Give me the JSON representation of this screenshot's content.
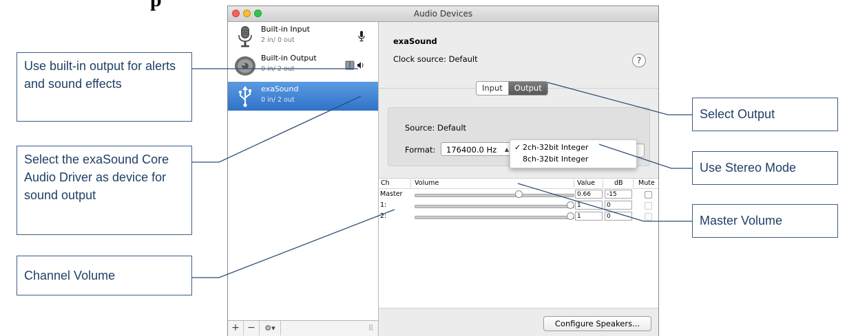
{
  "page": {
    "heading": "p"
  },
  "window": {
    "title": "Audio Devices"
  },
  "sidebar": {
    "devices": [
      {
        "name": "Built-in Input",
        "io": "2 in/ 0 out",
        "icon": "microphone-icon",
        "badge": "small-mic-icon"
      },
      {
        "name": "Built-in Output",
        "io": "0 in/ 2 out",
        "icon": "speaker-icon",
        "badge": "finder-speaker-icon"
      },
      {
        "name": "exaSound",
        "io": "0 in/ 2 out",
        "icon": "usb-icon",
        "selected": true
      }
    ],
    "footer": {
      "add": "+",
      "remove": "−",
      "gear": "⚙▾",
      "grip": "|||"
    }
  },
  "detail": {
    "device_title": "exaSound",
    "clock_source": "Clock source: Default",
    "help": "?",
    "tabs": [
      {
        "label": "Input"
      },
      {
        "label": "Output",
        "active": true
      }
    ],
    "source": "Source: Default",
    "format_label": "Format:",
    "format_value": "176400.0 Hz",
    "format_menu": [
      {
        "check": "✓",
        "label": "2ch-32bit Integer",
        "checked": true
      },
      {
        "check": "",
        "label": "8ch-32bit Integer",
        "checked": false
      }
    ],
    "table": {
      "headers": {
        "ch": "Ch",
        "volume": "Volume",
        "value": "Value",
        "db": "dB",
        "mute": "Mute"
      },
      "rows": [
        {
          "ch": "Master",
          "value": "0.66",
          "db": "-15",
          "level": 0.66,
          "mute_enabled": true
        },
        {
          "ch": "1:",
          "value": "1",
          "db": "0",
          "level": 1.0,
          "mute_enabled": false
        },
        {
          "ch": "2:",
          "value": "1",
          "db": "0",
          "level": 1.0,
          "mute_enabled": false
        }
      ]
    },
    "configure_button": "Configure Speakers..."
  },
  "callouts": {
    "builtin": "Use built-in output for alerts and sound effects",
    "exasound": "Select the exaSound Core Audio Driver as device for sound output",
    "channel_volume": "Channel Volume",
    "select_output": "Select Output",
    "stereo": "Use Stereo Mode",
    "master": "Master Volume"
  }
}
